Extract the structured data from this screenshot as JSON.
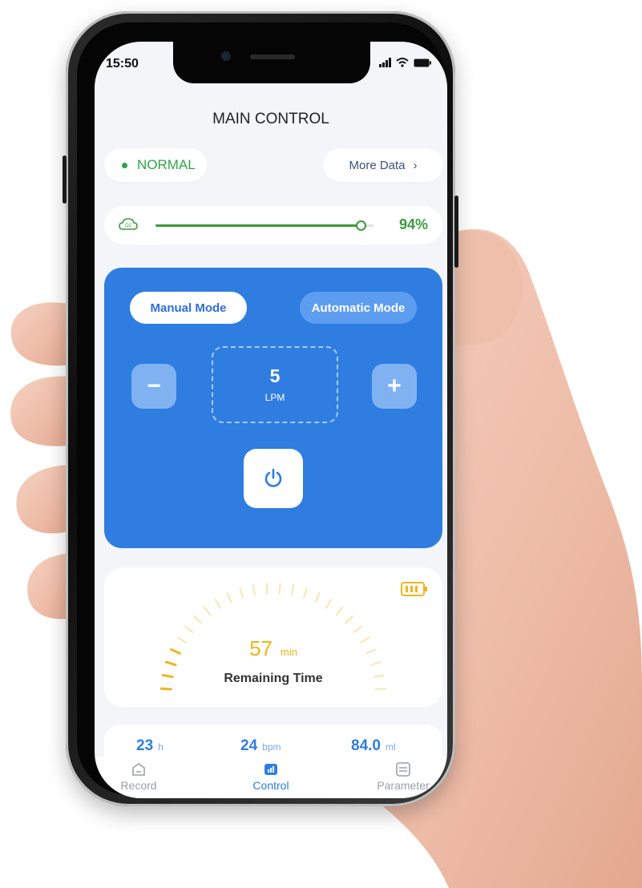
{
  "status_bar": {
    "time": "15:50"
  },
  "header": {
    "title": "MAIN CONTROL"
  },
  "status": {
    "state": "NORMAL",
    "state_color": "#2fa34a",
    "more_label": "More Data",
    "more_chevron": "›"
  },
  "concentration": {
    "percent_label": "94%",
    "level": 0.94,
    "icon": "oxygen-cloud-icon",
    "color": "#3a9b3c"
  },
  "control": {
    "accent": "#2f7de1",
    "modes": {
      "manual": "Manual Mode",
      "automatic": "Automatic Mode",
      "selected": "manual"
    },
    "flow": {
      "value": "5",
      "unit": "LPM"
    },
    "minus_label": "−",
    "plus_label": "+",
    "power_icon": "power-icon"
  },
  "timer": {
    "value": "57",
    "unit": "min",
    "label": "Remaining Time",
    "battery_icon": "battery-icon",
    "color": "#f0b51d"
  },
  "stats": [
    {
      "value": "23",
      "unit": "h"
    },
    {
      "value": "24",
      "unit": "bpm"
    },
    {
      "value": "84.0",
      "unit": "ml"
    }
  ],
  "tabs": [
    {
      "label": "Record",
      "icon": "home-icon"
    },
    {
      "label": "Control",
      "icon": "chart-icon",
      "active": true
    },
    {
      "label": "Parameter",
      "icon": "parameter-icon"
    }
  ]
}
